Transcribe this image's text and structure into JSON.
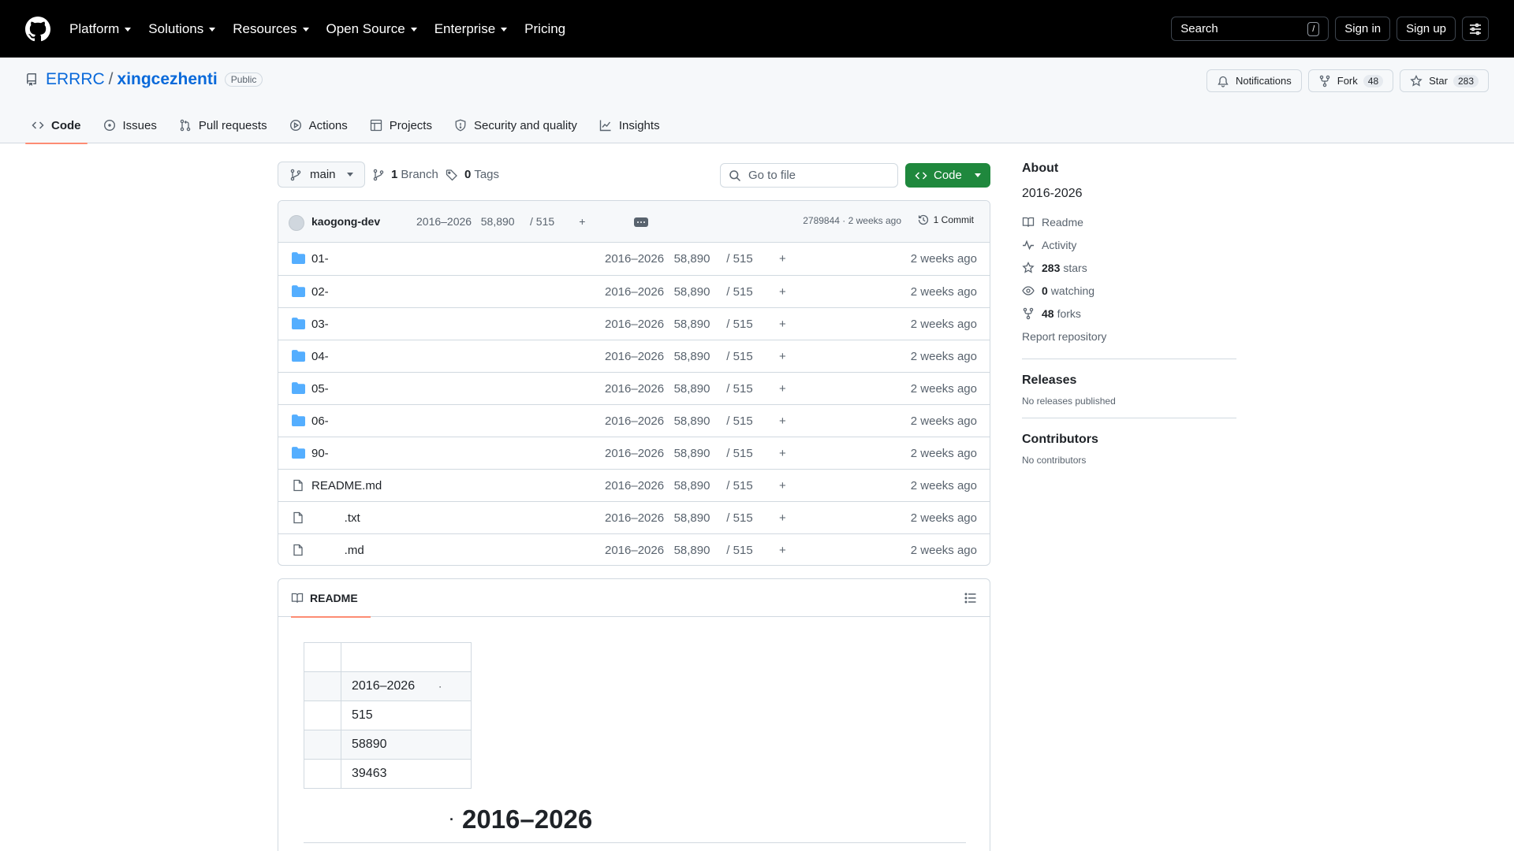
{
  "header": {
    "nav": [
      "Platform",
      "Solutions",
      "Resources",
      "Open Source",
      "Enterprise",
      "Pricing"
    ],
    "search_label": "Search",
    "search_key": "/",
    "sign_in": "Sign in",
    "sign_up": "Sign up"
  },
  "repo": {
    "owner": "ERRRC",
    "separator": "/",
    "name": "xingcezhenti",
    "visibility": "Public",
    "notifications": "Notifications",
    "fork_label": "Fork",
    "fork_count": "48",
    "star_label": "Star",
    "star_count": "283"
  },
  "tabs": [
    {
      "label": "Code"
    },
    {
      "label": "Issues"
    },
    {
      "label": "Pull requests"
    },
    {
      "label": "Actions"
    },
    {
      "label": "Projects"
    },
    {
      "label": "Security and quality"
    },
    {
      "label": "Insights"
    }
  ],
  "toolbar": {
    "branch": "main",
    "branch_count": "1",
    "branch_label": "Branch",
    "tag_count": "0",
    "tag_label": "Tags",
    "go_to_file": "Go to file",
    "code_label": "Code"
  },
  "commit": {
    "author": "kaogong-dev",
    "message": "2016–2026   58,890     / 515        +",
    "sha_time": "2789844 · 2 weeks ago",
    "count": "1 Commit"
  },
  "files": [
    {
      "name": "01-",
      "type": "folder",
      "message": "2016–2026   58,890     / 515        +",
      "time": "2 weeks ago"
    },
    {
      "name": "02-",
      "type": "folder",
      "message": "2016–2026   58,890     / 515        +",
      "time": "2 weeks ago"
    },
    {
      "name": "03-",
      "type": "folder",
      "message": "2016–2026   58,890     / 515        +",
      "time": "2 weeks ago"
    },
    {
      "name": "04-",
      "type": "folder",
      "message": "2016–2026   58,890     / 515        +",
      "time": "2 weeks ago"
    },
    {
      "name": "05-",
      "type": "folder",
      "message": "2016–2026   58,890     / 515        +",
      "time": "2 weeks ago"
    },
    {
      "name": "06-",
      "type": "folder",
      "message": "2016–2026   58,890     / 515        +",
      "time": "2 weeks ago"
    },
    {
      "name": "90-",
      "type": "folder",
      "message": "2016–2026   58,890     / 515        +",
      "time": "2 weeks ago"
    },
    {
      "name": "README.md",
      "type": "file",
      "message": "2016–2026   58,890     / 515        +",
      "time": "2 weeks ago"
    },
    {
      "name": "          .txt",
      "type": "file",
      "message": "2016–2026   58,890     / 515        +",
      "time": "2 weeks ago"
    },
    {
      "name": "          .md",
      "type": "file",
      "message": "2016–2026   58,890     / 515        +",
      "time": "2 weeks ago"
    }
  ],
  "readme": {
    "tab_label": "README",
    "table": [
      [
        "",
        ""
      ],
      [
        "",
        "2016–2026"
      ],
      [
        "",
        "515"
      ],
      [
        "",
        "58890"
      ],
      [
        "",
        "39463"
      ]
    ],
    "table_dot": "·",
    "heading_dot": "·",
    "heading": "2016–2026"
  },
  "sidebar": {
    "about_title": "About",
    "description": "2016-2026",
    "readme": "Readme",
    "activity": "Activity",
    "stars_count": "283",
    "stars_label": "stars",
    "watching_count": "0",
    "watching_label": "watching",
    "forks_count": "48",
    "forks_label": "forks",
    "report": "Report repository",
    "releases_title": "Releases",
    "releases_empty": "No releases published",
    "contributors_title": "Contributors",
    "contributors_empty": "No contributors"
  },
  "colors": {
    "header_bg": "#000000",
    "link": "#0969da",
    "code_button": "#1f883d",
    "tab_underline": "#fd8c73",
    "folder_icon": "#54aeff"
  }
}
